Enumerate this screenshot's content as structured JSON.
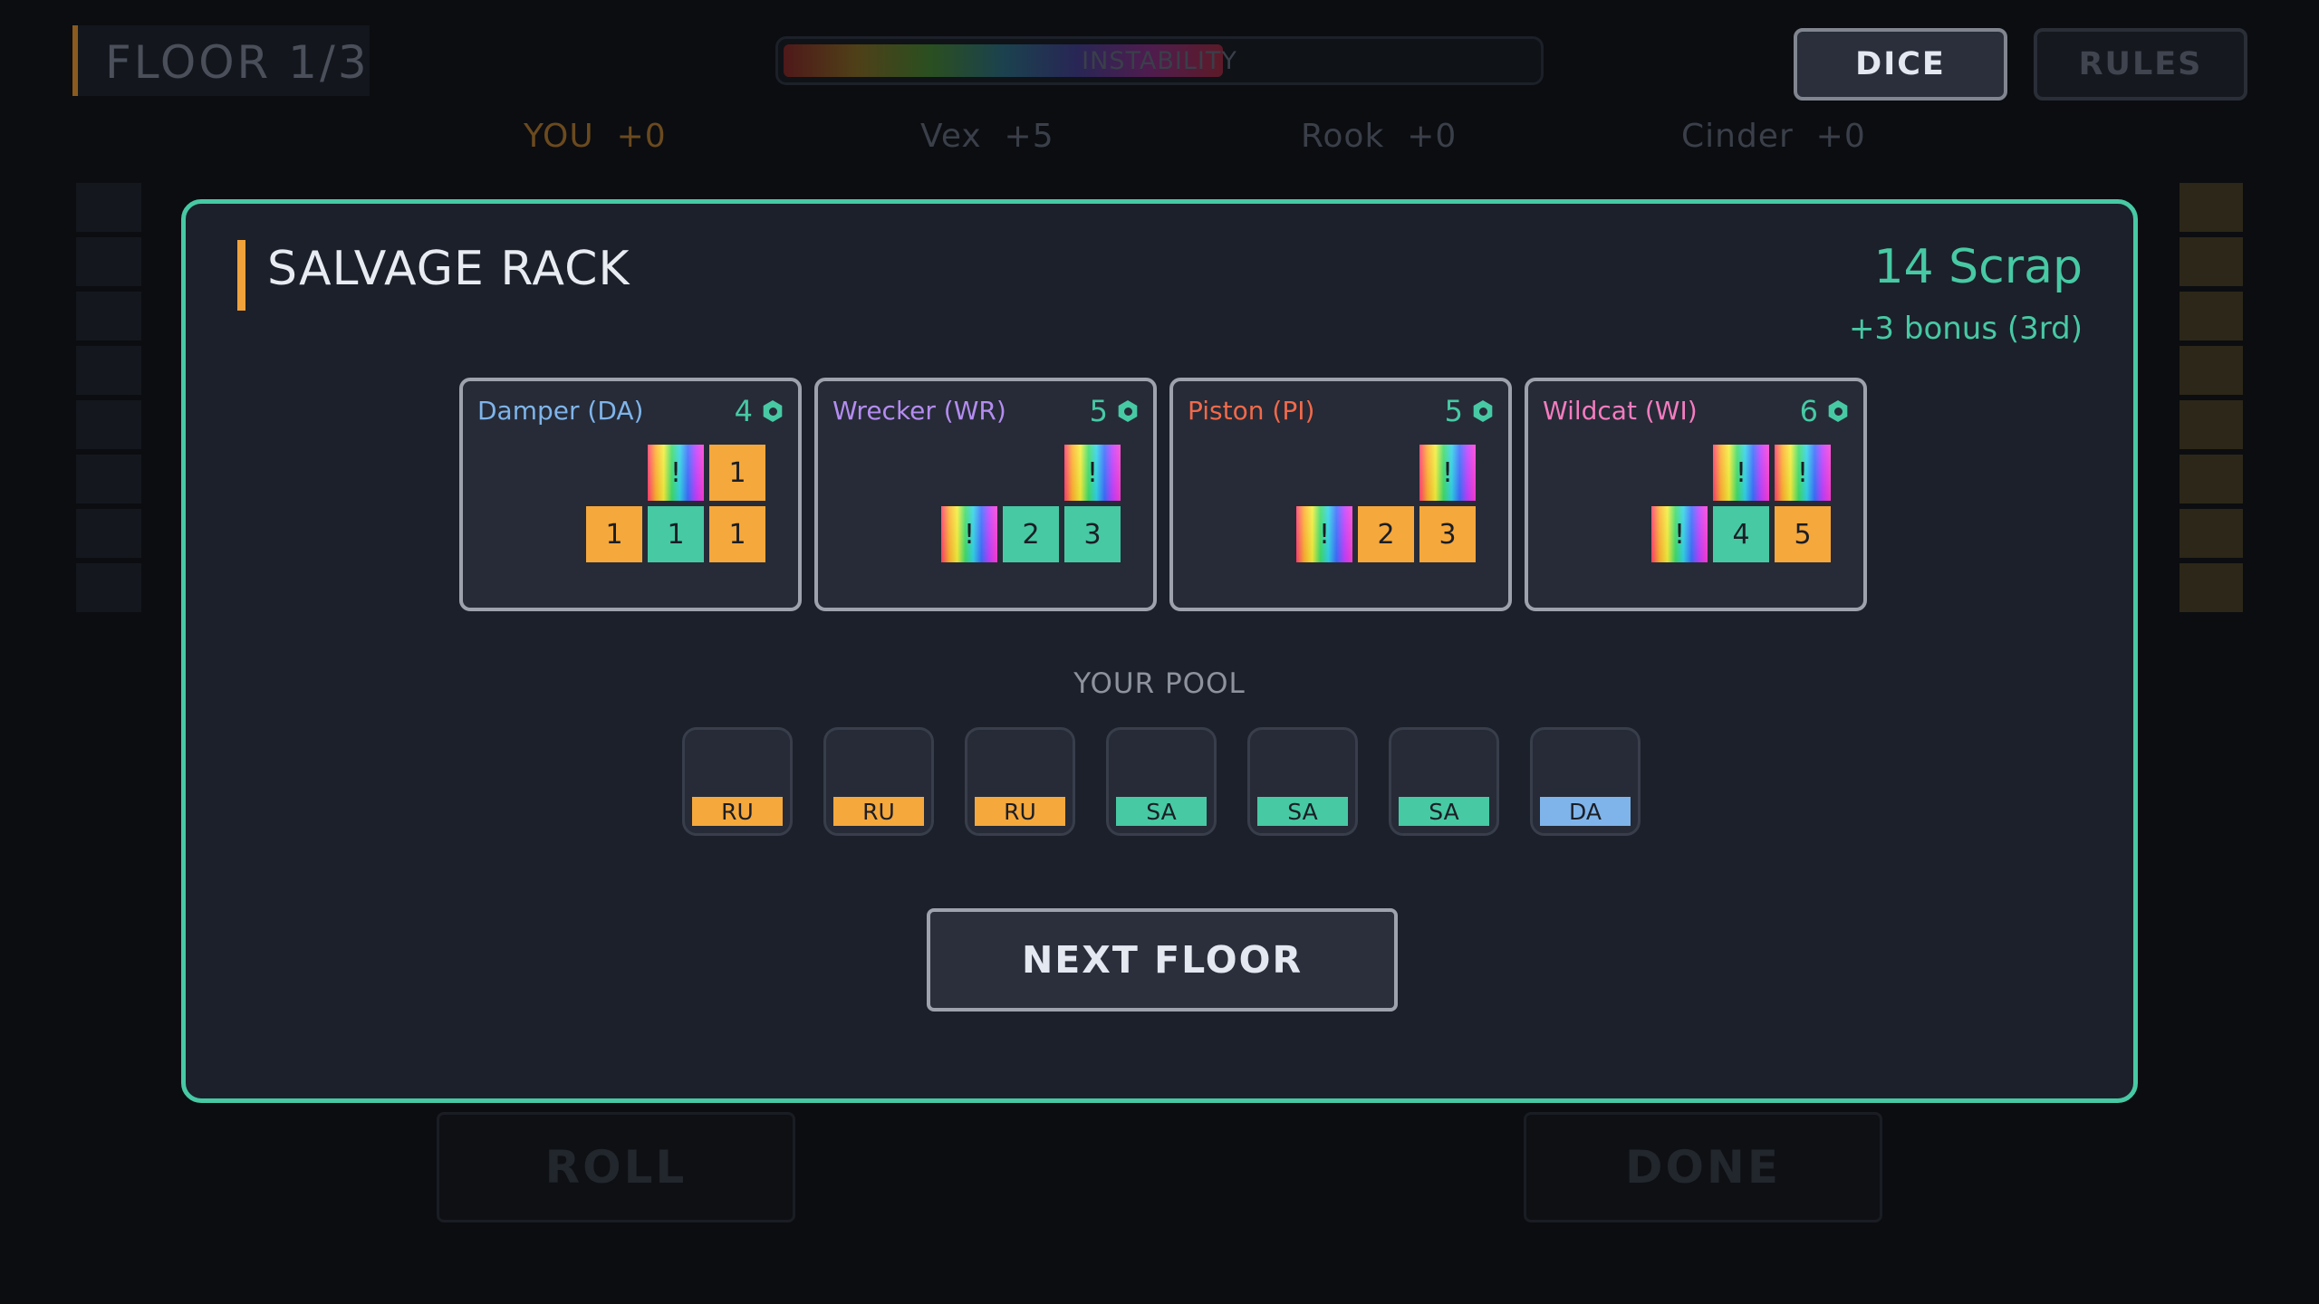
{
  "hud": {
    "floor": "FLOOR 1/3",
    "instability_label": "INSTABILITY",
    "instability_level": 0.58,
    "dice_label": "DICE",
    "rules_label": "RULES"
  },
  "players": [
    {
      "name": "YOU",
      "score": "+0",
      "color": "#6b4a1e"
    },
    {
      "name": "Vex",
      "score": "+5",
      "color": "#3a3f49"
    },
    {
      "name": "Rook",
      "score": "+0",
      "color": "#3a3f49"
    },
    {
      "name": "Cinder",
      "score": "+0",
      "color": "#3a3f49"
    }
  ],
  "background_actions": {
    "roll_label": "ROLL",
    "done_label": "DONE"
  },
  "modal": {
    "title": "SALVAGE RACK",
    "scrap": "14 Scrap",
    "bonus": "+3 bonus (3rd)",
    "cards": [
      {
        "name": "Damper (DA)",
        "color": "#7fb4ea",
        "cost": "4",
        "top": [
          {
            "t": "r",
            "v": "!"
          },
          {
            "t": "o",
            "v": "1"
          }
        ],
        "bottom": [
          {
            "t": "o",
            "v": "1"
          },
          {
            "t": "t",
            "v": "1"
          },
          {
            "t": "o",
            "v": "1"
          }
        ]
      },
      {
        "name": "Wrecker (WR)",
        "color": "#b48cf0",
        "cost": "5",
        "top": [
          {
            "t": "r",
            "v": "!"
          }
        ],
        "bottom": [
          {
            "t": "r",
            "v": "!"
          },
          {
            "t": "t",
            "v": "2"
          },
          {
            "t": "t",
            "v": "3"
          }
        ]
      },
      {
        "name": "Piston (PI)",
        "color": "#f2694a",
        "cost": "5",
        "top": [
          {
            "t": "r",
            "v": "!"
          }
        ],
        "bottom": [
          {
            "t": "r",
            "v": "!"
          },
          {
            "t": "o",
            "v": "2"
          },
          {
            "t": "o",
            "v": "3"
          }
        ]
      },
      {
        "name": "Wildcat (WI)",
        "color": "#f47cbf",
        "cost": "6",
        "top": [
          {
            "t": "r",
            "v": "!"
          },
          {
            "t": "r",
            "v": "!"
          }
        ],
        "bottom": [
          {
            "t": "r",
            "v": "!"
          },
          {
            "t": "t",
            "v": "4"
          },
          {
            "t": "o",
            "v": "5"
          }
        ]
      }
    ],
    "pool_title": "YOUR POOL",
    "pool": [
      {
        "label": "RU",
        "color": "#f5a83c"
      },
      {
        "label": "RU",
        "color": "#f5a83c"
      },
      {
        "label": "RU",
        "color": "#f5a83c"
      },
      {
        "label": "SA",
        "color": "#47c9a4"
      },
      {
        "label": "SA",
        "color": "#47c9a4"
      },
      {
        "label": "SA",
        "color": "#47c9a4"
      },
      {
        "label": "DA",
        "color": "#7fb4ea"
      }
    ],
    "next_label": "NEXT FLOOR"
  }
}
